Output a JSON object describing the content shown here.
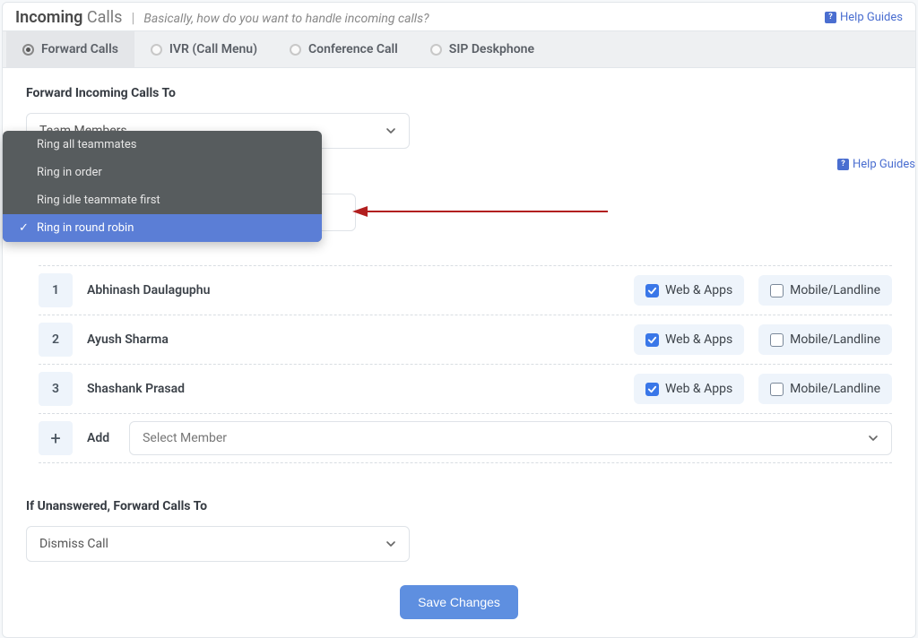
{
  "header": {
    "title_bold": "Incoming",
    "title_light": "Calls",
    "subtitle": "Basically, how do you want to handle incoming calls?",
    "help": "Help Guides"
  },
  "tabs": [
    {
      "label": "Forward Calls",
      "active": true
    },
    {
      "label": "IVR (Call Menu)",
      "active": false
    },
    {
      "label": "Conference Call",
      "active": false
    },
    {
      "label": "SIP Deskphone",
      "active": false
    }
  ],
  "forward_to": {
    "label": "Forward Incoming Calls To",
    "value": "Team Members"
  },
  "ring_options": {
    "items": [
      "Ring all teammates",
      "Ring in order",
      "Ring idle teammate first",
      "Ring in round robin"
    ],
    "selected_index": 3
  },
  "help2": "Help Guides",
  "members": [
    {
      "num": "1",
      "name": "Abhinash Daulaguphu",
      "web": true,
      "mobile": false
    },
    {
      "num": "2",
      "name": "Ayush Sharma",
      "web": true,
      "mobile": false
    },
    {
      "num": "3",
      "name": "Shashank Prasad",
      "web": true,
      "mobile": false
    }
  ],
  "chip_labels": {
    "web": "Web & Apps",
    "mobile": "Mobile/Landline"
  },
  "add_row": {
    "label": "Add",
    "placeholder": "Select Member"
  },
  "unanswered": {
    "label": "If Unanswered, Forward Calls To",
    "value": "Dismiss Call"
  },
  "save_label": "Save Changes"
}
